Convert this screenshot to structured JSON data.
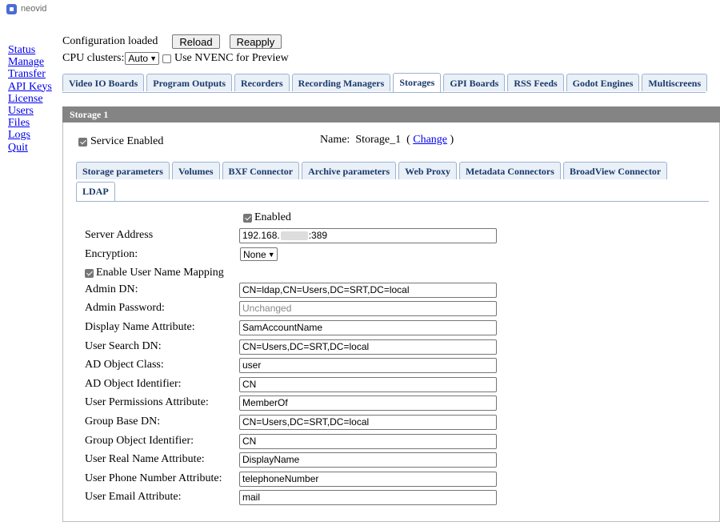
{
  "app": {
    "name": "neovid",
    "accent": "#4a6cd4"
  },
  "nav": [
    "Status",
    "Manage",
    "Transfer",
    "API Keys",
    "License",
    "Users",
    "Files",
    "Logs",
    "Quit"
  ],
  "header": {
    "status_text": "Configuration loaded",
    "reload_label": "Reload",
    "reapply_label": "Reapply",
    "cpu_label": "CPU clusters:",
    "cpu_value": "Auto",
    "nvenc_label": "Use NVENC for Preview",
    "nvenc_checked": false
  },
  "main_tabs": [
    "Video IO Boards",
    "Program Outputs",
    "Recorders",
    "Recording Managers",
    "Storages",
    "GPI Boards",
    "RSS Feeds",
    "Godot Engines",
    "Multiscreens"
  ],
  "main_tab_active": "Storages",
  "panel": {
    "title": "Storage 1",
    "service_label": "Service Enabled",
    "service_checked": true,
    "name_prefix": "Name:  Storage_1  (",
    "change_link": "Change",
    "name_suffix": ")"
  },
  "sub_tabs_row1": [
    "Storage parameters",
    "Volumes",
    "BXF Connector",
    "Archive parameters",
    "Web Proxy",
    "Metadata Connectors",
    "BroadView Connector"
  ],
  "sub_tabs_row2": [
    "LDAP"
  ],
  "sub_tab_active": "LDAP",
  "ldap": {
    "enabled_label": "Enabled",
    "enabled_checked": true,
    "server_address_label": "Server Address",
    "server_address_prefix": "192.168.",
    "server_address_suffix": ":389",
    "encryption_label": "Encryption:",
    "encryption_value": "None",
    "mapping_label": "Enable User Name Mapping",
    "mapping_checked": true,
    "fields": [
      {
        "label": "Admin DN:",
        "value": "CN=ldap,CN=Users,DC=SRT,DC=local"
      },
      {
        "label": "Admin Password:",
        "placeholder": "Unchanged"
      },
      {
        "label": "Display Name Attribute:",
        "value": "SamAccountName"
      },
      {
        "label": "User Search DN:",
        "value": "CN=Users,DC=SRT,DC=local"
      },
      {
        "label": "AD Object Class:",
        "value": "user"
      },
      {
        "label": "AD Object Identifier:",
        "value": "CN"
      },
      {
        "label": "User Permissions Attribute:",
        "value": "MemberOf"
      },
      {
        "label": "Group Base DN:",
        "value": "CN=Users,DC=SRT,DC=local"
      },
      {
        "label": "Group Object Identifier:",
        "value": "CN"
      },
      {
        "label": "User Real Name Attribute:",
        "value": "DisplayName"
      },
      {
        "label": "User Phone Number Attribute:",
        "value": "telephoneNumber"
      },
      {
        "label": "User Email Attribute:",
        "value": "mail"
      }
    ]
  }
}
